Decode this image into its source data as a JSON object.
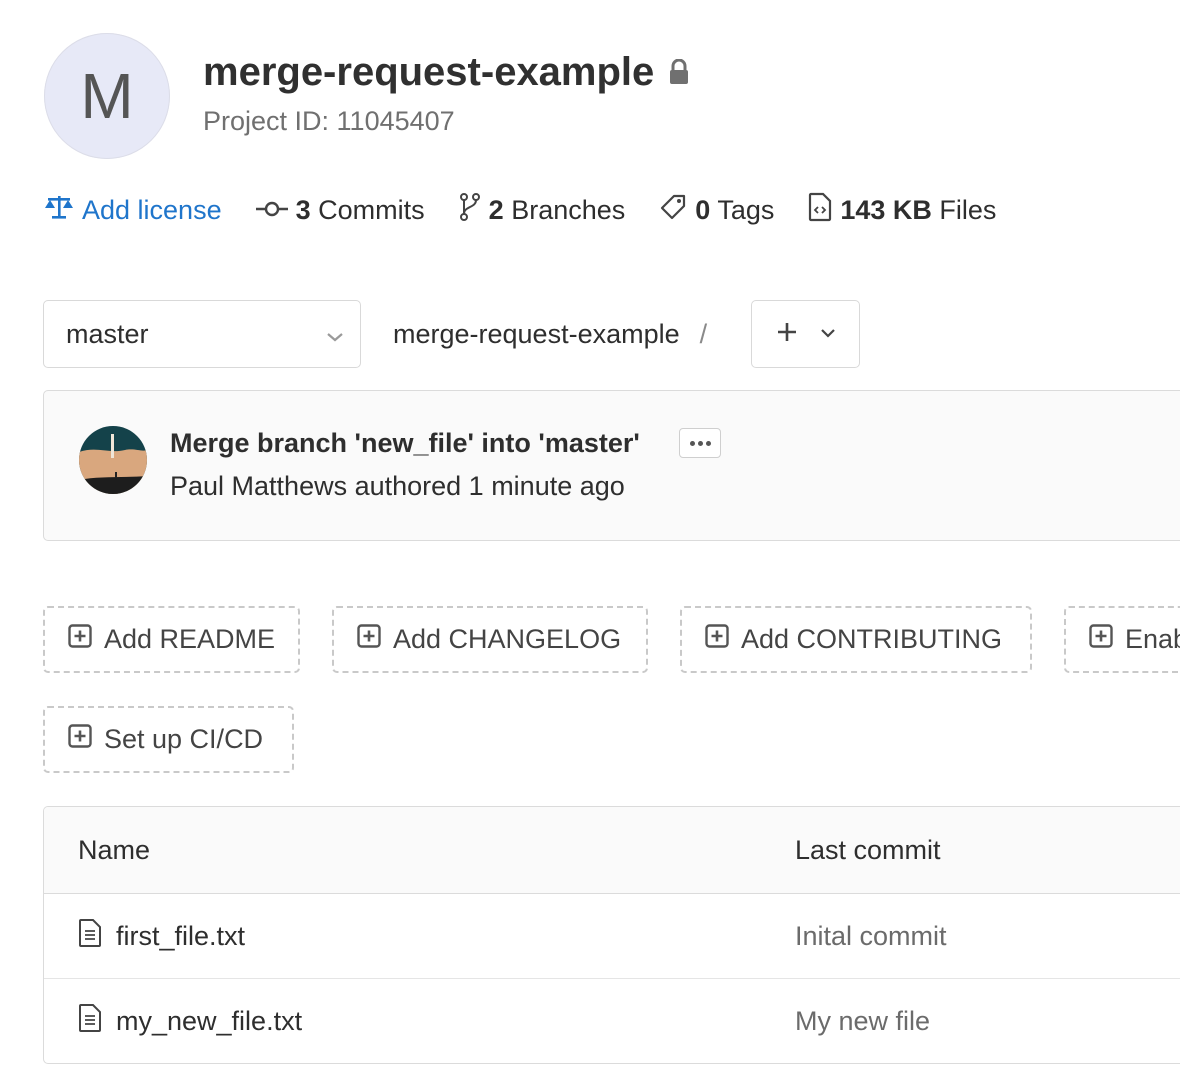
{
  "project": {
    "avatar_letter": "M",
    "name": "merge-request-example",
    "id_label": "Project ID: 11045407"
  },
  "stats": {
    "license": "Add license",
    "commits_count": "3",
    "commits_label": "Commits",
    "branches_count": "2",
    "branches_label": "Branches",
    "tags_count": "0",
    "tags_label": "Tags",
    "files_size": "143 KB",
    "files_label": "Files"
  },
  "repo": {
    "branch": "master",
    "breadcrumb_root": "merge-request-example",
    "separator": "/",
    "add_symbol": "+"
  },
  "last_commit": {
    "title": "Merge branch 'new_file' into 'master'",
    "meta": "Paul Matthews authored 1 minute ago"
  },
  "suggestions": [
    {
      "label": "Add README"
    },
    {
      "label": "Add CHANGELOG"
    },
    {
      "label": "Add CONTRIBUTING"
    },
    {
      "label": "Enable Auto DevOps"
    },
    {
      "label": "Set up CI/CD"
    }
  ],
  "table": {
    "headers": {
      "name": "Name",
      "last_commit": "Last commit"
    },
    "rows": [
      {
        "name": "first_file.txt",
        "last_commit": "Inital commit"
      },
      {
        "name": "my_new_file.txt",
        "last_commit": "My new file"
      }
    ]
  },
  "colors": {
    "link": "#1f75cb",
    "text": "#2e2e2e",
    "muted": "#707070"
  },
  "icons": {
    "license": "scale-icon",
    "commits": "commit-icon",
    "branches": "branch-icon",
    "tags": "tag-icon",
    "files": "file-icon",
    "lock": "lock-icon",
    "suggestion": "plus-square-icon",
    "file_row": "document-icon"
  }
}
